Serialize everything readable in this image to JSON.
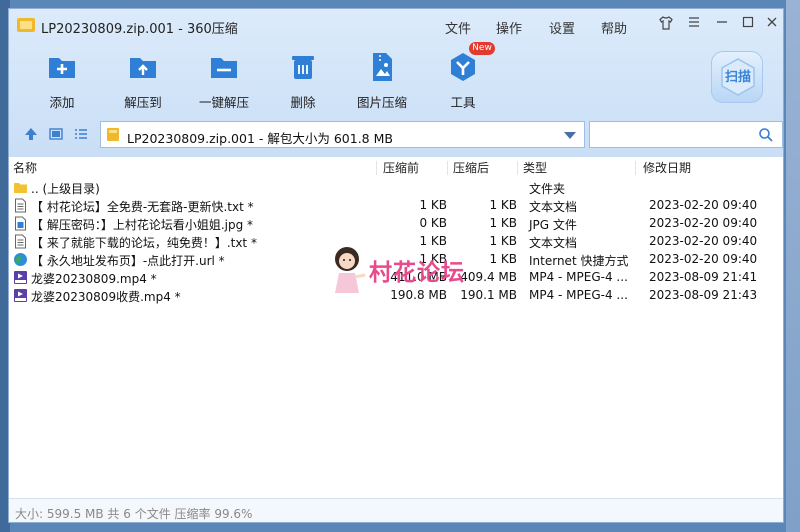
{
  "window": {
    "title": "LP20230809.zip.001 - 360压缩",
    "menu": [
      "文件",
      "操作",
      "设置",
      "帮助"
    ]
  },
  "toolbar": {
    "items": [
      {
        "label": "添加",
        "icon": "add-icon"
      },
      {
        "label": "解压到",
        "icon": "extract-to-icon"
      },
      {
        "label": "一键解压",
        "icon": "one-click-extract-icon"
      },
      {
        "label": "删除",
        "icon": "delete-icon"
      },
      {
        "label": "图片压缩",
        "icon": "image-compress-icon"
      },
      {
        "label": "工具",
        "icon": "tools-icon"
      }
    ],
    "new_badge": "New",
    "scan_label": "扫描"
  },
  "address": {
    "text": "LP20230809.zip.001 - 解包大小为 601.8 MB"
  },
  "columns": [
    "名称",
    "压缩前",
    "压缩后",
    "类型",
    "修改日期"
  ],
  "files": [
    {
      "icon": "folder-icon",
      "name": ".. (上级目录)",
      "before": "",
      "after": "",
      "type": "文件夹",
      "date": ""
    },
    {
      "icon": "text-file-icon",
      "name": "【 村花论坛】全免费-无套路-更新快.txt *",
      "before": "1 KB",
      "after": "1 KB",
      "type": "文本文档",
      "date": "2023-02-20 09:40"
    },
    {
      "icon": "image-file-icon",
      "name": "【 解压密码：】上村花论坛看小姐姐.jpg *",
      "before": "0 KB",
      "after": "1 KB",
      "type": "JPG 文件",
      "date": "2023-02-20 09:40"
    },
    {
      "icon": "text-file-icon",
      "name": "【 来了就能下载的论坛，纯免费！】.txt *",
      "before": "1 KB",
      "after": "1 KB",
      "type": "文本文档",
      "date": "2023-02-20 09:40"
    },
    {
      "icon": "globe-icon",
      "name": "【 永久地址发布页】-点此打开.url *",
      "before": "1 KB",
      "after": "1 KB",
      "type": "Internet 快捷方式",
      "date": "2023-02-20 09:40"
    },
    {
      "icon": "mp4-file-icon",
      "name": "龙婆20230809.mp4 *",
      "before": "411.0 MB",
      "after": "409.4 MB",
      "type": "MP4 - MPEG-4 ...",
      "date": "2023-08-09 21:41"
    },
    {
      "icon": "mp4-file-icon",
      "name": "龙婆20230809收费.mp4 *",
      "before": "190.8 MB",
      "after": "190.1 MB",
      "type": "MP4 - MPEG-4 ...",
      "date": "2023-08-09 21:43"
    }
  ],
  "watermark": {
    "text": "村花论坛"
  },
  "status": {
    "text": "大小: 599.5 MB 共 6 个文件 压缩率 99.6%"
  },
  "colors": {
    "accent": "#2f7fd6",
    "watermark": "#e84a8e",
    "toolbar_bg": "#d4e6fa"
  }
}
